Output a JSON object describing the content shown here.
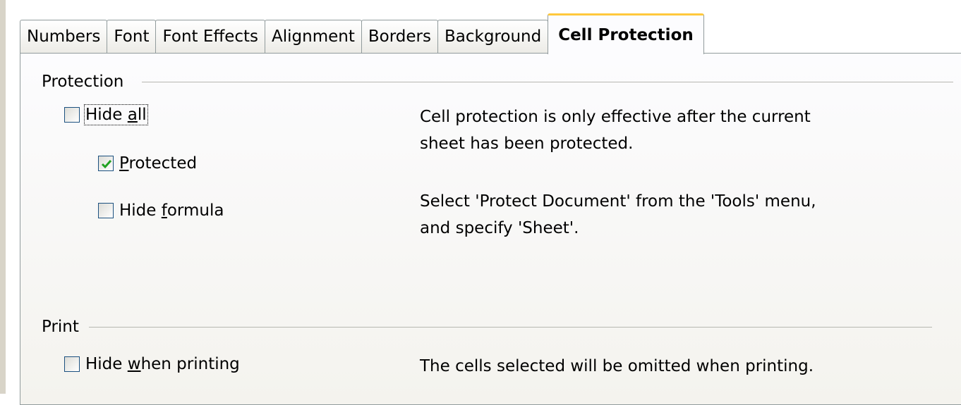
{
  "tabs": [
    {
      "label": "Numbers",
      "active": false
    },
    {
      "label": "Font",
      "active": false
    },
    {
      "label": "Font Effects",
      "active": false
    },
    {
      "label": "Alignment",
      "active": false
    },
    {
      "label": "Borders",
      "active": false
    },
    {
      "label": "Background",
      "active": false
    },
    {
      "label": "Cell Protection",
      "active": true
    }
  ],
  "protection": {
    "group_label": "Protection",
    "hide_all": {
      "pre": "Hide ",
      "mnemonic": "a",
      "post": "ll",
      "checked": false
    },
    "protected": {
      "pre": "",
      "mnemonic": "P",
      "post": "rotected",
      "checked": true
    },
    "hide_formula": {
      "pre": "Hide ",
      "mnemonic": "f",
      "post": "ormula",
      "checked": false
    },
    "info_line1": "Cell protection is only effective after the current",
    "info_line2": "sheet has been protected.",
    "info_line3": "Select 'Protect Document' from the 'Tools' menu,",
    "info_line4": "and specify 'Sheet'."
  },
  "print": {
    "group_label": "Print",
    "hide_when_printing": {
      "pre": "Hide ",
      "mnemonic": "w",
      "post": "hen printing",
      "checked": false
    },
    "info": "The cells selected will be omitted when printing."
  },
  "colors": {
    "accent_tab": "#ffc83c",
    "check": "#21a121",
    "checkbox_border": "#1c5180"
  }
}
